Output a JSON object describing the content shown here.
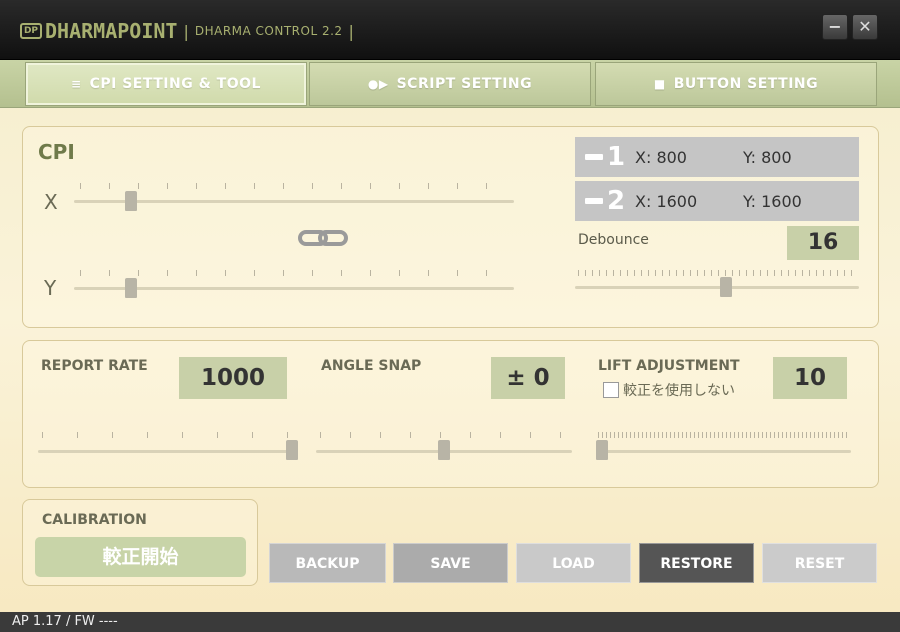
{
  "titlebar": {
    "logo_mark": "DP",
    "logo_text": "DHARMAPOINT",
    "separator": "|",
    "app_title": "DHARMA CONTROL 2.2",
    "minimize": "−",
    "close": "✕"
  },
  "tabs": [
    {
      "label": "CPI SETTING & TOOL",
      "icon": "sliders-icon",
      "glyph": "≡",
      "active": true
    },
    {
      "label": "SCRIPT SETTING",
      "icon": "record-play-icon",
      "glyph": "●▶",
      "active": false
    },
    {
      "label": "BUTTON SETTING",
      "icon": "button-icon",
      "glyph": "■",
      "active": false
    }
  ],
  "cpi": {
    "title": "CPI",
    "x_label": "X",
    "y_label": "Y",
    "link_icon": "chain-link-icon",
    "x_level": 0.07,
    "y_level": 0.07,
    "presets": [
      {
        "index": "1",
        "x": "X:  800",
        "y": "Y:  800"
      },
      {
        "index": "2",
        "x": "X:  1600",
        "y": "Y:  1600"
      }
    ],
    "debounce_label": "Debounce",
    "debounce_value": "16",
    "debounce_level": 0.53
  },
  "settings": {
    "report_rate_label": "REPORT RATE",
    "report_rate_value": "1000",
    "report_rate_level": 1.0,
    "angle_snap_label": "ANGLE SNAP",
    "angle_snap_value": "± 0",
    "angle_snap_level": 0.5,
    "lift_label": "LIFT ADJUSTMENT",
    "lift_value": "10",
    "lift_level": 0.0,
    "calibration_checkbox_label": "較正を使用しない",
    "calibration_checkbox_checked": false
  },
  "calibration": {
    "title": "CALIBRATION",
    "start_button": "較正開始"
  },
  "actions": {
    "backup": "BACKUP",
    "save": "SAVE",
    "load": "LOAD",
    "restore": "RESTORE",
    "reset": "RESET"
  },
  "status": {
    "version": "AP 1.17  /  FW ----"
  },
  "colors": {
    "tab_bg": "#c9d4a6",
    "value_box": "#c8d0a8",
    "restore_button": "#555555",
    "panel_bg": "#faf3d9"
  }
}
